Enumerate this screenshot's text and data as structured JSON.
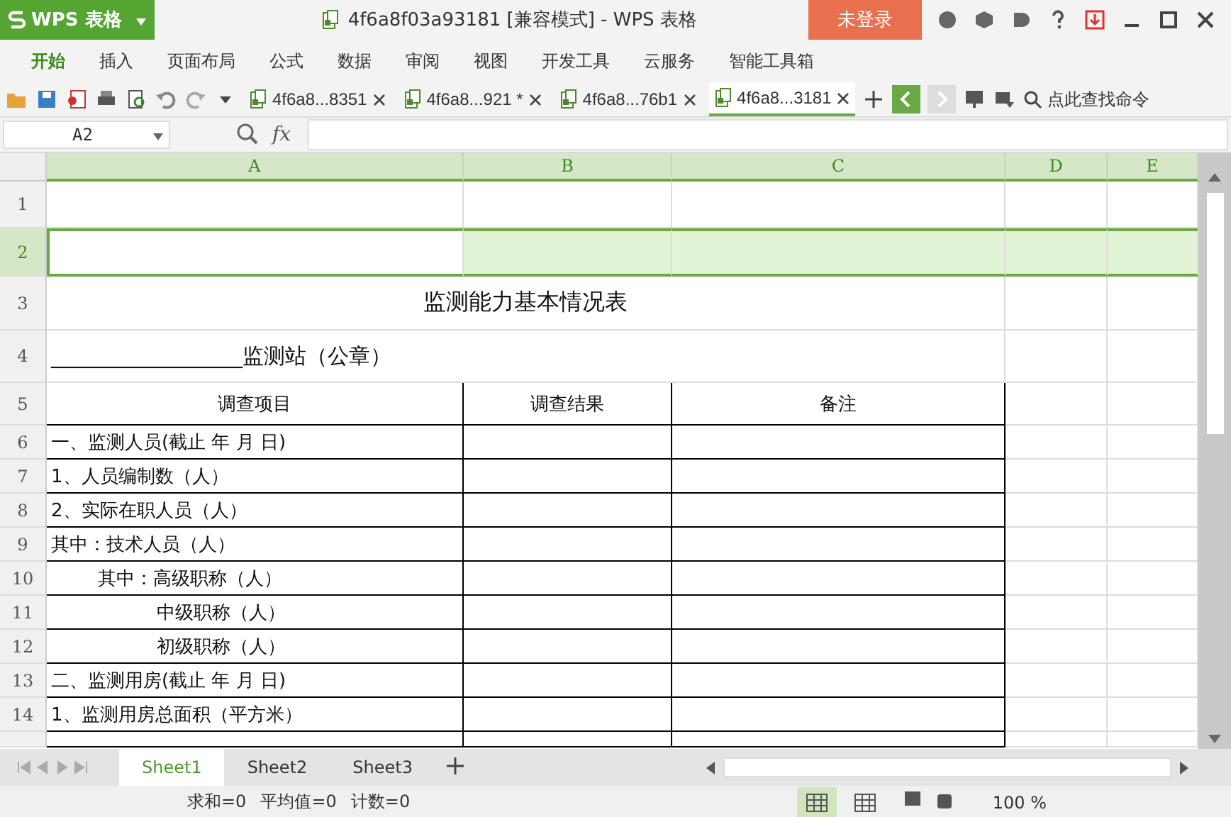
{
  "app_button": {
    "label": "WPS 表格"
  },
  "window": {
    "title": "4f6a8f03a93181 [兼容模式] - WPS 表格",
    "login": "未登录"
  },
  "menu": [
    {
      "label": "开始",
      "selected": true
    },
    {
      "label": "插入",
      "selected": false
    },
    {
      "label": "页面布局",
      "selected": false
    },
    {
      "label": "公式",
      "selected": false
    },
    {
      "label": "数据",
      "selected": false
    },
    {
      "label": "审阅",
      "selected": false
    },
    {
      "label": "视图",
      "selected": false
    },
    {
      "label": "开发工具",
      "selected": false
    },
    {
      "label": "云服务",
      "selected": false
    },
    {
      "label": "智能工具箱",
      "selected": false
    }
  ],
  "doc_tabs": [
    {
      "label": "4f6a8...8351",
      "selected": false
    },
    {
      "label": "4f6a8...921 *",
      "selected": false
    },
    {
      "label": "4f6a8...76b1",
      "selected": false
    },
    {
      "label": "4f6a8...3181",
      "selected": true
    }
  ],
  "command_search": {
    "placeholder": "点此查找命令"
  },
  "formula_bar": {
    "name_box": "A2",
    "fx": "fx"
  },
  "columns": [
    {
      "label": "A",
      "selected": true
    },
    {
      "label": "B",
      "selected": true
    },
    {
      "label": "C",
      "selected": true
    },
    {
      "label": "D",
      "selected": true
    },
    {
      "label": "E",
      "selected": true
    }
  ],
  "rows": [
    {
      "number": "1",
      "selected": false,
      "kind": "blank"
    },
    {
      "number": "2",
      "selected": true,
      "kind": "blank"
    },
    {
      "number": "3",
      "selected": false,
      "kind": "title",
      "text": "监测能力基本情况表"
    },
    {
      "number": "4",
      "selected": false,
      "kind": "stamp",
      "text": "__________________监测站（公章）"
    },
    {
      "number": "5",
      "selected": false,
      "kind": "header",
      "cells": [
        "调查项目",
        "调查结果",
        "备注"
      ]
    },
    {
      "number": "6",
      "selected": false,
      "kind": "item",
      "text": "一、监测人员(截止 年 月 日)"
    },
    {
      "number": "7",
      "selected": false,
      "kind": "item",
      "text": "1、人员编制数（人）"
    },
    {
      "number": "8",
      "selected": false,
      "kind": "item",
      "text": "2、实际在职人员（人）"
    },
    {
      "number": "9",
      "selected": false,
      "kind": "item",
      "text": "其中：技术人员（人）"
    },
    {
      "number": "10",
      "selected": false,
      "kind": "item",
      "text": "        其中：高级职称（人）"
    },
    {
      "number": "11",
      "selected": false,
      "kind": "item",
      "text": "                  中级职称（人）"
    },
    {
      "number": "12",
      "selected": false,
      "kind": "item",
      "text": "                  初级职称（人）"
    },
    {
      "number": "13",
      "selected": false,
      "kind": "item",
      "text": "二、监测用房(截止 年 月 日)"
    },
    {
      "number": "14",
      "selected": false,
      "kind": "item",
      "text": "1、监测用房总面积（平方米）"
    }
  ],
  "sheet_tabs": [
    {
      "label": "Sheet1",
      "selected": true
    },
    {
      "label": "Sheet2",
      "selected": false
    },
    {
      "label": "Sheet3",
      "selected": false
    }
  ],
  "status_bar": {
    "stats": [
      "求和=0",
      "平均值=0",
      "计数=0"
    ],
    "zoom": "100 %",
    "views": [
      {
        "selected": true
      },
      {
        "selected": false
      }
    ]
  }
}
